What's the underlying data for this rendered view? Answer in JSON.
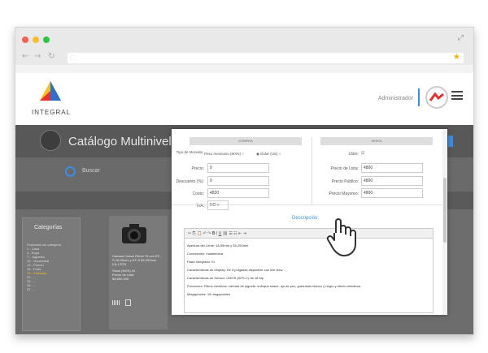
{
  "browser": {
    "back_icon": "back-arrow-icon",
    "forward_icon": "forward-arrow-icon",
    "reload_icon": "reload-icon",
    "star_icon": "star-icon",
    "expand_icon": "expand-icon"
  },
  "header": {
    "logo_text": "INTEGRAL",
    "admin_label": "Administrador"
  },
  "catalog": {
    "title": "Catálogo Multinivel",
    "search_placeholder": "Buscar"
  },
  "sidebar": {
    "title": "Categorías",
    "items": [
      "Productos sin categoria",
      "1 - Casa",
      "4 - Ropa",
      "7 - Juguetes",
      "10 - Vacacional",
      "13 - Premio",
      "16 - Fruta",
      "19 - Cámaras",
      "22 - ...",
      "25 - ...",
      "28 - ...",
      "31 - ..."
    ]
  },
  "product": {
    "name": "Cámara Canon Rebel T6 con EF-S 18-55mm y EF-S 55-250mm",
    "code": "CA-CRT6",
    "stock": "Stock (MXN) 10",
    "price_label": "Precio de Lista",
    "price": "$4,850.000"
  },
  "modal": {
    "compra_label": "COMPRA",
    "venta_label": "VENTA",
    "tipo_moneda_label": "Tipo de Moneda",
    "currency_mxn": "Peso mexicano (MXN)",
    "currency_usd": "Dolar (US)",
    "precio_label": "Precio:",
    "precio_value": "0",
    "descuento_label": "Descuento (%):",
    "descuento_value": "0",
    "costo_label": "Costo:",
    "costo_value": "4830",
    "iva_label": "IVA:",
    "iva_value": "NO",
    "libre_label": "Libre:",
    "lista_label": "Precio de Lista:",
    "lista_value": "4800",
    "publico_label": "Precio Público:",
    "publico_value": "4800",
    "mayoreo_label": "Precio Mayoreo:",
    "mayoreo_value": "4800",
    "descripcion_label": "Descripción:"
  },
  "editor": {
    "lines": [
      "Apertura del Lente: 18-55mm y 55-250mm",
      "Conexiones: Inalámbrica",
      "Flash Integrado: Sí",
      "Características de Display: De 3 pulgadas disponible con live view",
      "Características de Sensor: CMOS (APS-C) de 18 Mp",
      "Funciones: Filtros creativos: cámara de juguete, enfoque suave, ojo de pez, granulado blanco y negro y efecto miniatura",
      "Megapíxeles: 18 megapíxeles"
    ]
  },
  "colors": {
    "accent": "#3a8ee6",
    "logo_red": "#e8312f",
    "logo_blue": "#2f6fcf",
    "logo_yellow": "#f5c21b"
  }
}
